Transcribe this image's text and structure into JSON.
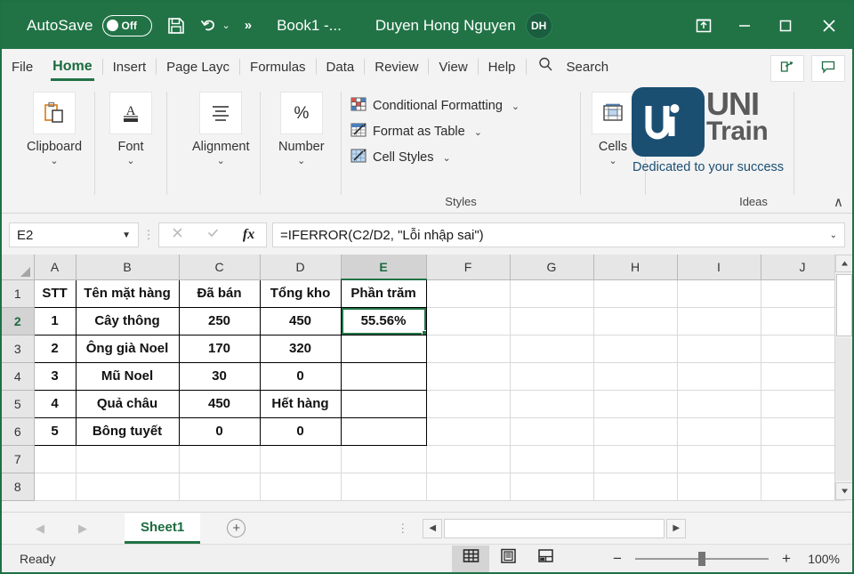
{
  "titlebar": {
    "autosave_label": "AutoSave",
    "autosave_state": "Off",
    "save_icon": "save-icon",
    "undo_icon": "undo-icon",
    "more_commands": "»",
    "document_title": "Book1  -...",
    "user_name": "Duyen Hong Nguyen",
    "avatar_initials": "DH",
    "restore_icon": "restore-window-icon",
    "minimize_icon": "minimize-icon",
    "maximize_icon": "maximize-icon",
    "close_icon": "close-icon",
    "background": "#217346"
  },
  "tabs": [
    {
      "label": "File",
      "active": false
    },
    {
      "label": "Home",
      "active": true
    },
    {
      "label": "Insert",
      "active": false
    },
    {
      "label": "Page Layc",
      "active": false
    },
    {
      "label": "Formulas",
      "active": false
    },
    {
      "label": "Data",
      "active": false
    },
    {
      "label": "Review",
      "active": false
    },
    {
      "label": "View",
      "active": false
    },
    {
      "label": "Help",
      "active": false
    }
  ],
  "search": {
    "label": "Search",
    "icon": "search-icon"
  },
  "header_buttons": [
    {
      "name": "share-button",
      "icon": "share-icon"
    },
    {
      "name": "comments-button",
      "icon": "comment-icon"
    }
  ],
  "ribbon": {
    "groups": [
      {
        "label": "Clipboard",
        "button": "Clipboard",
        "icon": "clipboard-icon",
        "chevron": "⌄"
      },
      {
        "label": "Font",
        "button": "Font",
        "icon": "font-icon",
        "chevron": "⌄"
      },
      {
        "label": "Alignment",
        "button": "Alignment",
        "icon": "alignment-icon",
        "chevron": "⌄"
      },
      {
        "label": "Number",
        "button": "Number",
        "icon": "percent-icon",
        "chevron": "⌄"
      },
      {
        "label": "Cells",
        "button": "Cells",
        "icon": "cells-icon",
        "chevron": "⌄"
      }
    ],
    "styles_group": {
      "label": "Styles",
      "items": [
        {
          "label": "Conditional Formatting",
          "icon": "conditional-formatting-icon",
          "chevron": "⌄"
        },
        {
          "label": "Format as Table",
          "icon": "format-as-table-icon",
          "chevron": "⌄"
        },
        {
          "label": "Cell Styles",
          "icon": "cell-styles-icon",
          "chevron": "⌄"
        }
      ]
    },
    "ideas_group": {
      "label": "Ideas"
    },
    "collapse_icon": "∧"
  },
  "watermark": {
    "mark": "uni",
    "word_top": "UNI",
    "word_bottom": "Train",
    "tagline": "Dedicated to your success",
    "brand_color": "#1b4f72"
  },
  "formula_bar": {
    "name_box": "E2",
    "name_box_chevron": "▼",
    "cancel_icon": "cancel-icon",
    "confirm_icon": "confirm-icon",
    "function_icon": "fx",
    "formula": "=IFERROR(C2/D2, \"Lỗi nhập sai\")",
    "expand_chevron": "⌄"
  },
  "grid": {
    "columns": [
      "A",
      "B",
      "C",
      "D",
      "E",
      "F",
      "G",
      "H",
      "I",
      "J"
    ],
    "selected_column": "E",
    "rows": [
      "1",
      "2",
      "3",
      "4",
      "5",
      "6",
      "7",
      "8"
    ],
    "selected_row": "2",
    "selected_cell": "E2",
    "data": [
      {
        "A": "STT",
        "B": "Tên mặt hàng",
        "C": "Đã bán",
        "D": "Tổng kho",
        "E": "Phần trăm"
      },
      {
        "A": "1",
        "B": "Cây thông",
        "C": "250",
        "D": "450",
        "E": "55.56%"
      },
      {
        "A": "2",
        "B": "Ông già Noel",
        "C": "170",
        "D": "320",
        "E": ""
      },
      {
        "A": "3",
        "B": "Mũ Noel",
        "C": "30",
        "D": "0",
        "E": ""
      },
      {
        "A": "4",
        "B": "Quả châu",
        "C": "450",
        "D": "Hết hàng",
        "E": ""
      },
      {
        "A": "5",
        "B": "Bông tuyết",
        "C": "0",
        "D": "0",
        "E": ""
      },
      {
        "A": "",
        "B": "",
        "C": "",
        "D": "",
        "E": ""
      },
      {
        "A": "",
        "B": "",
        "C": "",
        "D": "",
        "E": ""
      }
    ],
    "selection_color": "#217346"
  },
  "sheet_tabs": {
    "prev_icon": "◀",
    "next_icon": "▶",
    "sheets": [
      {
        "label": "Sheet1",
        "active": true
      }
    ],
    "add_sheet_icon": "+"
  },
  "scrollbars": {
    "v_up_icon": "▲",
    "v_down_icon": "▼",
    "h_left_icon": "◀",
    "h_right_icon": "▶"
  },
  "status_bar": {
    "status": "Ready",
    "views": [
      {
        "name": "normal-view-button",
        "icon": "normal-view-icon",
        "active": true
      },
      {
        "name": "page-layout-view-button",
        "icon": "page-layout-icon",
        "active": false
      },
      {
        "name": "page-break-view-button",
        "icon": "page-break-icon",
        "active": false
      }
    ],
    "zoom_out": "−",
    "zoom_in": "+",
    "zoom_level": "100%"
  }
}
